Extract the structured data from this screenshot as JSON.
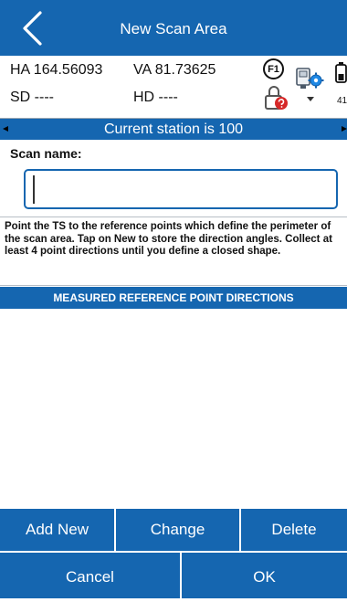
{
  "header": {
    "title": "New Scan Area",
    "back_icon": "chevron-left-icon"
  },
  "measurements": {
    "ha": "HA 164.56093",
    "va": "VA 81.73625",
    "sd": "SD ----",
    "hd": "HD ----"
  },
  "status_icons": {
    "f1_label": "F1",
    "battery_percent": "41%"
  },
  "station": {
    "text": "Current station is 100"
  },
  "scan": {
    "label": "Scan name:",
    "value": ""
  },
  "instructions": "Point the TS to the reference points which define the perimeter of the scan area. Tap on New to store the direction angles. Collect at least 4 point directions until you define a closed shape.",
  "list": {
    "header": "MEASURED REFERENCE POINT DIRECTIONS",
    "items": []
  },
  "actions": {
    "add_new": "Add New",
    "change": "Change",
    "delete": "Delete",
    "cancel": "Cancel",
    "ok": "OK"
  },
  "colors": {
    "primary": "#1566b0",
    "background": "#ffffff"
  }
}
